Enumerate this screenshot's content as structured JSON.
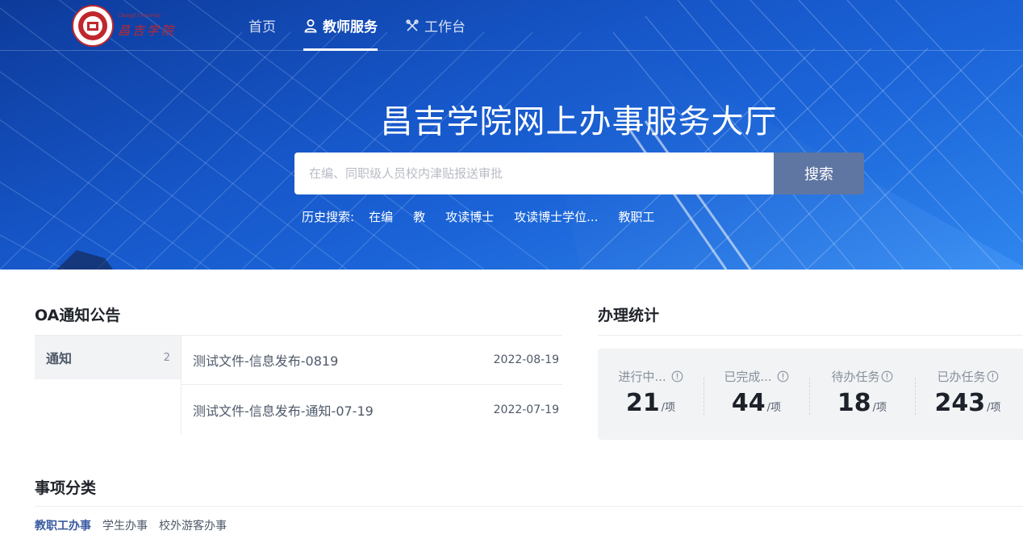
{
  "header": {
    "logo_text": "昌吉学院",
    "logo_sub": "Changji University",
    "nav": [
      {
        "label": "首页",
        "icon": "none",
        "active": false
      },
      {
        "label": "教师服务",
        "icon": "user-icon",
        "active": true
      },
      {
        "label": "工作台",
        "icon": "tools-icon",
        "active": false
      }
    ]
  },
  "hero": {
    "title": "昌吉学院网上办事服务大厅",
    "search_placeholder": "在编、同职级人员校内津贴报送审批",
    "search_button": "搜索",
    "history_label": "历史搜索:",
    "history": [
      "在编",
      "教",
      "攻读博士",
      "攻读博士学位...",
      "教职工"
    ]
  },
  "oa": {
    "title": "OA通知公告",
    "tab": {
      "label": "通知",
      "count": "2"
    },
    "items": [
      {
        "title": "测试文件-信息发布-0819",
        "date": "2022-08-19"
      },
      {
        "title": "测试文件-信息发布-通知-07-19",
        "date": "2022-07-19"
      }
    ]
  },
  "stats": {
    "title": "办理统计",
    "unit": "/项",
    "items": [
      {
        "label": "进行中...",
        "value": "21",
        "has_info": true
      },
      {
        "label": "已完成...",
        "value": "44",
        "has_info": true
      },
      {
        "label": "待办任务",
        "value": "18",
        "has_info": true
      },
      {
        "label": "已办任务",
        "value": "243",
        "has_info": true
      }
    ]
  },
  "categories": {
    "title": "事项分类",
    "tabs": [
      {
        "label": "教职工办事",
        "active": true
      },
      {
        "label": "学生办事",
        "active": false
      },
      {
        "label": "校外游客办事",
        "active": false
      }
    ]
  },
  "colors": {
    "hero_blue": "#1656c8",
    "search_button": "#5f76a2",
    "active_category": "#3a5ba0",
    "logo_red": "#c0272d"
  }
}
